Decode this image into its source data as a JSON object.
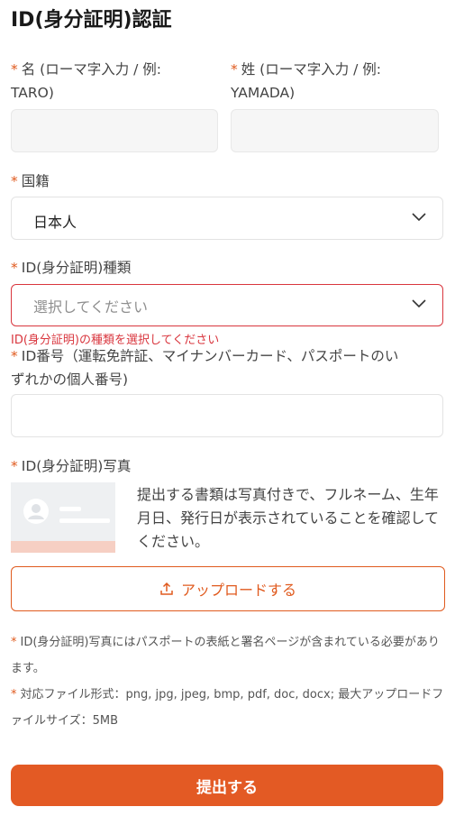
{
  "title": "ID(身分証明)認証",
  "required_mark": "*",
  "first_name": {
    "label_line1": "名 (ローマ字入力 / 例:",
    "label_line2": "TARO)",
    "value": ""
  },
  "last_name": {
    "label_line1": "姓 (ローマ字入力 / 例:",
    "label_line2": "YAMADA)",
    "value": ""
  },
  "nationality": {
    "label": "国籍",
    "value": "日本人"
  },
  "id_type": {
    "label": "ID(身分証明)種類",
    "placeholder": "選択してください",
    "error": "ID(身分証明)の種類を選択してください"
  },
  "id_number": {
    "label_line1": "ID番号（運転免許証、マイナンバーカード、パスポートのい",
    "label_line2": "ずれかの個人番号)",
    "value": ""
  },
  "id_photo": {
    "label": "ID(身分証明)写真",
    "description": "提出する書類は写真付きで、フルネーム、生年月日、発行日が表示されていることを確認してください。",
    "upload_label": "アップロードする"
  },
  "notes": [
    "ID(身分証明)写真にはパスポートの表紙と署名ページが含まれている必要があります。",
    "対応ファイル形式：png, jpg, jpeg, bmp, pdf, doc, docx; 最大アップロードファイルサイズ：5MB"
  ],
  "submit_label": "提出する",
  "colors": {
    "accent": "#e35a24",
    "error": "#d9363e"
  },
  "icons": [
    "chevron-down-icon",
    "upload-icon",
    "id-card-placeholder-icon"
  ]
}
